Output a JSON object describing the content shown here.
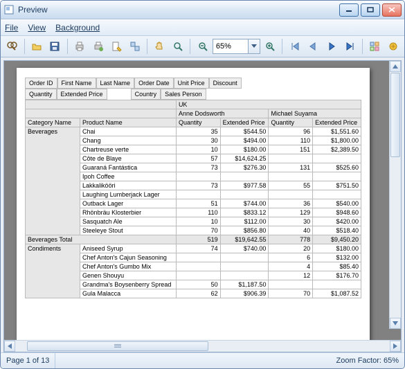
{
  "window": {
    "title": "Preview"
  },
  "menu": {
    "file": "File",
    "view": "View",
    "background": "Background"
  },
  "toolbar": {
    "zoom_value": "65%"
  },
  "status": {
    "page": "Page 1 of 13",
    "zoom": "Zoom Factor: 65%"
  },
  "report": {
    "field_buttons_row1": [
      "Order ID",
      "First Name",
      "Last Name",
      "Order Date",
      "Unit Price",
      "Discount"
    ],
    "field_buttons_row2_left": [
      "Quantity",
      "Extended Price"
    ],
    "field_buttons_row2_right": [
      "Country",
      "Sales Person"
    ],
    "country": "UK",
    "persons": [
      "Anne Dodsworth",
      "Michael Suyama"
    ],
    "col_headers_left": [
      "Category Name",
      "Product Name"
    ],
    "value_headers": [
      "Quantity",
      "Extended Price"
    ],
    "groups": [
      {
        "category": "Beverages",
        "rows": [
          {
            "product": "Chai",
            "v": [
              35,
              "$544.50",
              96,
              "$1,551.60"
            ]
          },
          {
            "product": "Chang",
            "v": [
              30,
              "$494.00",
              110,
              "$1,800.00"
            ]
          },
          {
            "product": "Chartreuse verte",
            "v": [
              10,
              "$180.00",
              151,
              "$2,389.50"
            ]
          },
          {
            "product": "Côte de Blaye",
            "v": [
              57,
              "$14,624.25",
              "",
              ""
            ]
          },
          {
            "product": "Guaraná Fantástica",
            "v": [
              73,
              "$276.30",
              131,
              "$525.60"
            ]
          },
          {
            "product": "Ipoh Coffee",
            "v": [
              "",
              "",
              "",
              ""
            ]
          },
          {
            "product": "Lakkalikööri",
            "v": [
              73,
              "$977.58",
              55,
              "$751.50"
            ]
          },
          {
            "product": "Laughing Lumberjack Lager",
            "v": [
              "",
              "",
              "",
              ""
            ]
          },
          {
            "product": "Outback Lager",
            "v": [
              51,
              "$744.00",
              36,
              "$540.00"
            ]
          },
          {
            "product": "Rhönbräu Klosterbier",
            "v": [
              110,
              "$833.12",
              129,
              "$948.60"
            ]
          },
          {
            "product": "Sasquatch Ale",
            "v": [
              10,
              "$112.00",
              30,
              "$420.00"
            ]
          },
          {
            "product": "Steeleye Stout",
            "v": [
              70,
              "$856.80",
              40,
              "$518.40"
            ]
          }
        ],
        "total_label": "Beverages Total",
        "total": [
          "519",
          "$19,642.55",
          "778",
          "$9,450.20"
        ]
      },
      {
        "category": "Condiments",
        "rows": [
          {
            "product": "Aniseed Syrup",
            "v": [
              74,
              "$740.00",
              20,
              "$180.00"
            ]
          },
          {
            "product": "Chef Anton's Cajun Seasoning",
            "v": [
              "",
              "",
              6,
              "$132.00"
            ]
          },
          {
            "product": "Chef Anton's Gumbo Mix",
            "v": [
              "",
              "",
              4,
              "$85.40"
            ]
          },
          {
            "product": "Genen Shouyu",
            "v": [
              "",
              "",
              12,
              "$176.70"
            ]
          },
          {
            "product": "Grandma's Boysenberry Spread",
            "v": [
              50,
              "$1,187.50",
              "",
              ""
            ]
          },
          {
            "product": "Gula Malacca",
            "v": [
              62,
              "$906.39",
              70,
              "$1,087.52"
            ]
          }
        ]
      }
    ]
  },
  "chart_data": {
    "type": "table",
    "title": "Pivot report preview",
    "column_dimension": "Sales Person (under Country=UK)",
    "row_dimensions": [
      "Category Name",
      "Product Name"
    ],
    "measures": [
      "Quantity",
      "Extended Price"
    ],
    "columns": [
      "Anne Dodsworth",
      "Michael Suyama"
    ],
    "data": [
      {
        "category": "Beverages",
        "product": "Chai",
        "Anne Dodsworth": {
          "Quantity": 35,
          "Extended Price": 544.5
        },
        "Michael Suyama": {
          "Quantity": 96,
          "Extended Price": 1551.6
        }
      },
      {
        "category": "Beverages",
        "product": "Chang",
        "Anne Dodsworth": {
          "Quantity": 30,
          "Extended Price": 494.0
        },
        "Michael Suyama": {
          "Quantity": 110,
          "Extended Price": 1800.0
        }
      },
      {
        "category": "Beverages",
        "product": "Chartreuse verte",
        "Anne Dodsworth": {
          "Quantity": 10,
          "Extended Price": 180.0
        },
        "Michael Suyama": {
          "Quantity": 151,
          "Extended Price": 2389.5
        }
      },
      {
        "category": "Beverages",
        "product": "Côte de Blaye",
        "Anne Dodsworth": {
          "Quantity": 57,
          "Extended Price": 14624.25
        },
        "Michael Suyama": {
          "Quantity": null,
          "Extended Price": null
        }
      },
      {
        "category": "Beverages",
        "product": "Guaraná Fantástica",
        "Anne Dodsworth": {
          "Quantity": 73,
          "Extended Price": 276.3
        },
        "Michael Suyama": {
          "Quantity": 131,
          "Extended Price": 525.6
        }
      },
      {
        "category": "Beverages",
        "product": "Ipoh Coffee",
        "Anne Dodsworth": {
          "Quantity": null,
          "Extended Price": null
        },
        "Michael Suyama": {
          "Quantity": null,
          "Extended Price": null
        }
      },
      {
        "category": "Beverages",
        "product": "Lakkalikööri",
        "Anne Dodsworth": {
          "Quantity": 73,
          "Extended Price": 977.58
        },
        "Michael Suyama": {
          "Quantity": 55,
          "Extended Price": 751.5
        }
      },
      {
        "category": "Beverages",
        "product": "Laughing Lumberjack Lager",
        "Anne Dodsworth": {
          "Quantity": null,
          "Extended Price": null
        },
        "Michael Suyama": {
          "Quantity": null,
          "Extended Price": null
        }
      },
      {
        "category": "Beverages",
        "product": "Outback Lager",
        "Anne Dodsworth": {
          "Quantity": 51,
          "Extended Price": 744.0
        },
        "Michael Suyama": {
          "Quantity": 36,
          "Extended Price": 540.0
        }
      },
      {
        "category": "Beverages",
        "product": "Rhönbräu Klosterbier",
        "Anne Dodsworth": {
          "Quantity": 110,
          "Extended Price": 833.12
        },
        "Michael Suyama": {
          "Quantity": 129,
          "Extended Price": 948.6
        }
      },
      {
        "category": "Beverages",
        "product": "Sasquatch Ale",
        "Anne Dodsworth": {
          "Quantity": 10,
          "Extended Price": 112.0
        },
        "Michael Suyama": {
          "Quantity": 30,
          "Extended Price": 420.0
        }
      },
      {
        "category": "Beverages",
        "product": "Steeleye Stout",
        "Anne Dodsworth": {
          "Quantity": 70,
          "Extended Price": 856.8
        },
        "Michael Suyama": {
          "Quantity": 40,
          "Extended Price": 518.4
        }
      },
      {
        "category": "Condiments",
        "product": "Aniseed Syrup",
        "Anne Dodsworth": {
          "Quantity": 74,
          "Extended Price": 740.0
        },
        "Michael Suyama": {
          "Quantity": 20,
          "Extended Price": 180.0
        }
      },
      {
        "category": "Condiments",
        "product": "Chef Anton's Cajun Seasoning",
        "Anne Dodsworth": {
          "Quantity": null,
          "Extended Price": null
        },
        "Michael Suyama": {
          "Quantity": 6,
          "Extended Price": 132.0
        }
      },
      {
        "category": "Condiments",
        "product": "Chef Anton's Gumbo Mix",
        "Anne Dodsworth": {
          "Quantity": null,
          "Extended Price": null
        },
        "Michael Suyama": {
          "Quantity": 4,
          "Extended Price": 85.4
        }
      },
      {
        "category": "Condiments",
        "product": "Genen Shouyu",
        "Anne Dodsworth": {
          "Quantity": null,
          "Extended Price": null
        },
        "Michael Suyama": {
          "Quantity": 12,
          "Extended Price": 176.7
        }
      },
      {
        "category": "Condiments",
        "product": "Grandma's Boysenberry Spread",
        "Anne Dodsworth": {
          "Quantity": 50,
          "Extended Price": 1187.5
        },
        "Michael Suyama": {
          "Quantity": null,
          "Extended Price": null
        }
      },
      {
        "category": "Condiments",
        "product": "Gula Malacca",
        "Anne Dodsworth": {
          "Quantity": 62,
          "Extended Price": 906.39
        },
        "Michael Suyama": {
          "Quantity": 70,
          "Extended Price": 1087.52
        }
      }
    ],
    "subtotals": [
      {
        "category": "Beverages",
        "Anne Dodsworth": {
          "Quantity": 519,
          "Extended Price": 19642.55
        },
        "Michael Suyama": {
          "Quantity": 778,
          "Extended Price": 9450.2
        }
      }
    ]
  }
}
